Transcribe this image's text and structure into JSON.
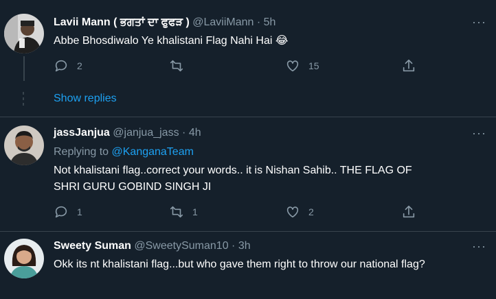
{
  "tweets": [
    {
      "name": "Lavii Mann ( ਭਗਤਾਂ ਦਾ ਫੁਫੜ )",
      "handle": "@LaviiMann",
      "sep": "·",
      "time": "5h",
      "text": "Abbe Bhosdiwalo Ye khalistani Flag Nahi Hai",
      "emoji": "😂",
      "replies": "2",
      "retweets": "",
      "likes": "15"
    },
    {
      "name": "jassJanjua",
      "handle": "@janjua_jass",
      "sep": "·",
      "time": "4h",
      "replying_label": "Replying to",
      "replying_to": "@KanganaTeam",
      "text": "Not khalistani flag..correct your words.. it is Nishan Sahib.. THE FLAG OF SHRI GURU GOBIND SINGH JI",
      "replies": "1",
      "retweets": "1",
      "likes": "2"
    },
    {
      "name": "Sweety Suman",
      "handle": "@SweetySuman10",
      "sep": "·",
      "time": "3h",
      "text": "Okk its nt khalistani flag...but who gave them right to throw our national flag?"
    }
  ],
  "show_replies": "Show replies",
  "more_icon": "···",
  "icons": [
    "reply-icon",
    "retweet-icon",
    "like-icon",
    "share-icon",
    "more-icon"
  ],
  "colors": {
    "background": "#15202b",
    "secondary_text": "#8899a6",
    "link": "#1da1f2",
    "divider": "#38444d"
  }
}
